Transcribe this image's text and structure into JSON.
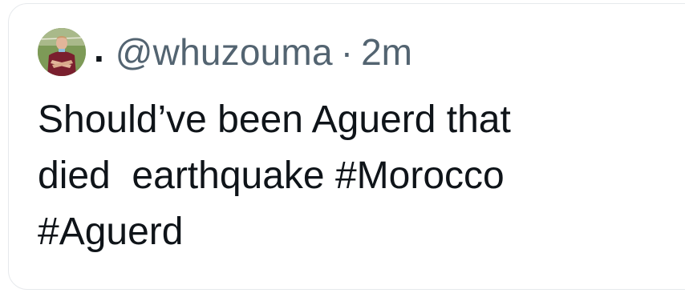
{
  "tweet": {
    "author": {
      "display_name": ".",
      "handle": "@whuzouma",
      "avatar_icon": "user-avatar-icon"
    },
    "separator": "·",
    "timestamp": "2m",
    "text": {
      "line1": "Should’ve been Aguerd that",
      "line2_prefix": "died  earthquake ",
      "hashtag1": "#Morocco",
      "hashtag2": "#Aguerd"
    }
  },
  "colors": {
    "text_primary": "#0f1419",
    "text_secondary": "#536471",
    "border": "#e6e9ec",
    "background": "#ffffff"
  }
}
